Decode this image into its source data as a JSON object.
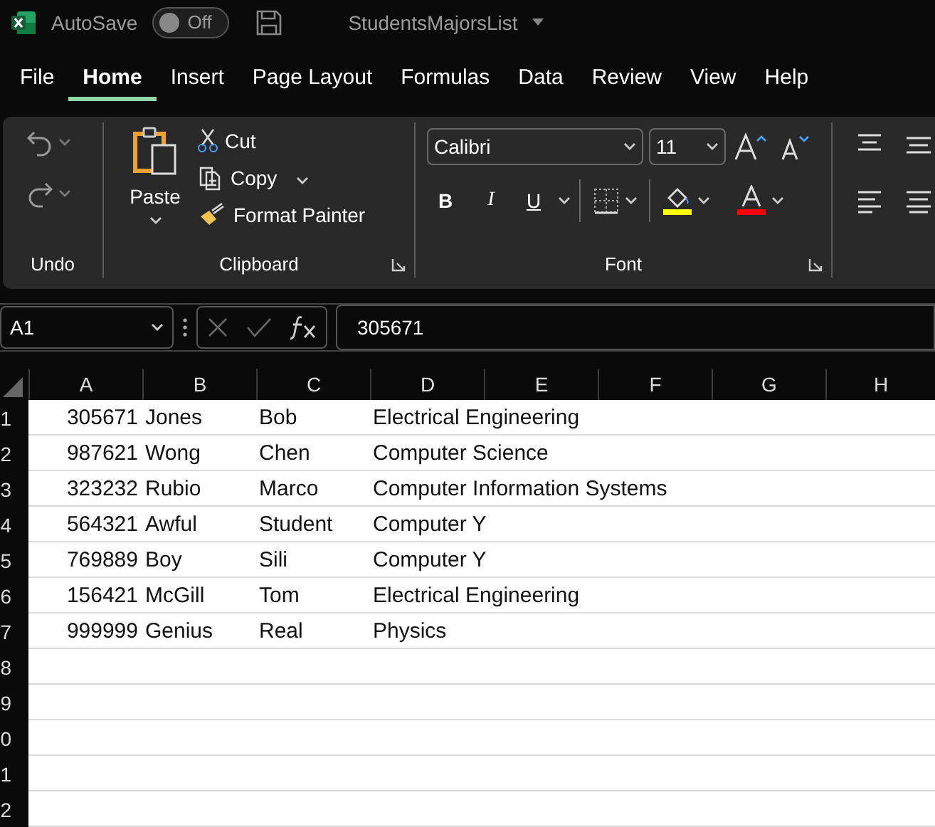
{
  "title_bar": {
    "autosave_label": "AutoSave",
    "autosave": {
      "on": false,
      "label": "Off"
    },
    "file_name": "StudentsMajorsList"
  },
  "tabs": [
    {
      "label": "File",
      "selected": false
    },
    {
      "label": "Home",
      "selected": true
    },
    {
      "label": "Insert",
      "selected": false
    },
    {
      "label": "Page Layout",
      "selected": false
    },
    {
      "label": "Formulas",
      "selected": false
    },
    {
      "label": "Data",
      "selected": false
    },
    {
      "label": "Review",
      "selected": false
    },
    {
      "label": "View",
      "selected": false
    },
    {
      "label": "Help",
      "selected": false
    }
  ],
  "ribbon": {
    "undo_group": {
      "label": "Undo"
    },
    "clipboard_group": {
      "label": "Clipboard",
      "paste": "Paste",
      "cut": "Cut",
      "copy": "Copy",
      "format_painter": "Format Painter"
    },
    "font_group": {
      "label": "Font",
      "font_name": "Calibri",
      "font_size": "11",
      "bold": "B",
      "italic": "I",
      "underline": "U"
    }
  },
  "formula_bar": {
    "name_box": "A1",
    "formula": "305671"
  },
  "sheet": {
    "columns": [
      "A",
      "B",
      "C",
      "D",
      "E",
      "F",
      "G",
      "H"
    ],
    "rows": [
      {
        "header": "1",
        "cells": [
          "305671",
          "Jones",
          "Bob",
          "Electrical Engineering"
        ]
      },
      {
        "header": "2",
        "cells": [
          "987621",
          "Wong",
          "Chen",
          "Computer Science"
        ]
      },
      {
        "header": "3",
        "cells": [
          "323232",
          "Rubio",
          "Marco",
          "Computer Information Systems"
        ]
      },
      {
        "header": "4",
        "cells": [
          "564321",
          "Awful",
          "Student",
          "Computer Y"
        ]
      },
      {
        "header": "5",
        "cells": [
          "769889",
          "Boy",
          "Sili",
          "Computer Y"
        ]
      },
      {
        "header": "6",
        "cells": [
          "156421",
          "McGill",
          "Tom",
          "Electrical Engineering"
        ]
      },
      {
        "header": "7",
        "cells": [
          "999999",
          "Genius",
          "Real",
          "Physics"
        ]
      },
      {
        "header": "8",
        "cells": []
      },
      {
        "header": "9",
        "cells": []
      },
      {
        "header": "0",
        "cells": []
      },
      {
        "header": "1",
        "cells": []
      },
      {
        "header": "2",
        "cells": []
      }
    ]
  }
}
